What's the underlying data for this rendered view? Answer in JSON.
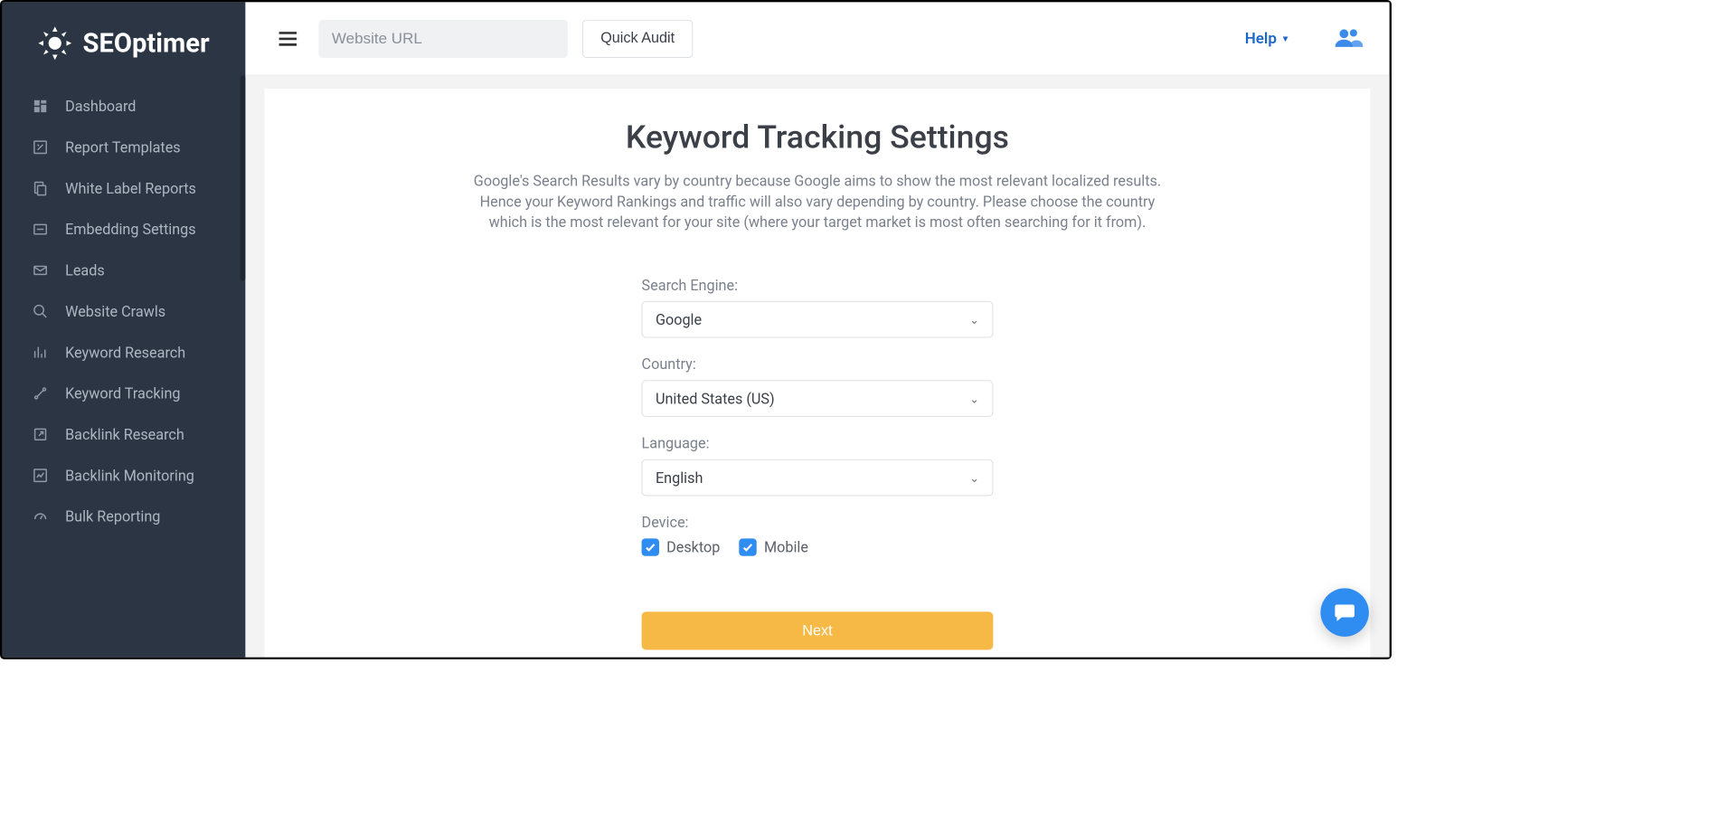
{
  "brand": {
    "name": "SEOptimer"
  },
  "sidebar": {
    "items": [
      {
        "label": "Dashboard"
      },
      {
        "label": "Report Templates"
      },
      {
        "label": "White Label Reports"
      },
      {
        "label": "Embedding Settings"
      },
      {
        "label": "Leads"
      },
      {
        "label": "Website Crawls"
      },
      {
        "label": "Keyword Research"
      },
      {
        "label": "Keyword Tracking"
      },
      {
        "label": "Backlink Research"
      },
      {
        "label": "Backlink Monitoring"
      },
      {
        "label": "Bulk Reporting"
      }
    ]
  },
  "topbar": {
    "url_placeholder": "Website URL",
    "quick_audit_label": "Quick Audit",
    "help_label": "Help"
  },
  "page": {
    "title": "Keyword Tracking Settings",
    "description": "Google's Search Results vary by country because Google aims to show the most relevant localized results. Hence your Keyword Rankings and traffic will also vary depending by country. Please choose the country which is the most relevant for your site (where your target market is most often searching for it from)."
  },
  "form": {
    "search_engine_label": "Search Engine:",
    "search_engine_value": "Google",
    "country_label": "Country:",
    "country_value": "United States (US)",
    "language_label": "Language:",
    "language_value": "English",
    "device_label": "Device:",
    "device_desktop_label": "Desktop",
    "device_mobile_label": "Mobile",
    "next_label": "Next"
  },
  "colors": {
    "sidebar_bg": "#2c3543",
    "accent_blue": "#2f8cf0",
    "accent_orange": "#f7b946",
    "link_blue": "#1d68c4"
  }
}
